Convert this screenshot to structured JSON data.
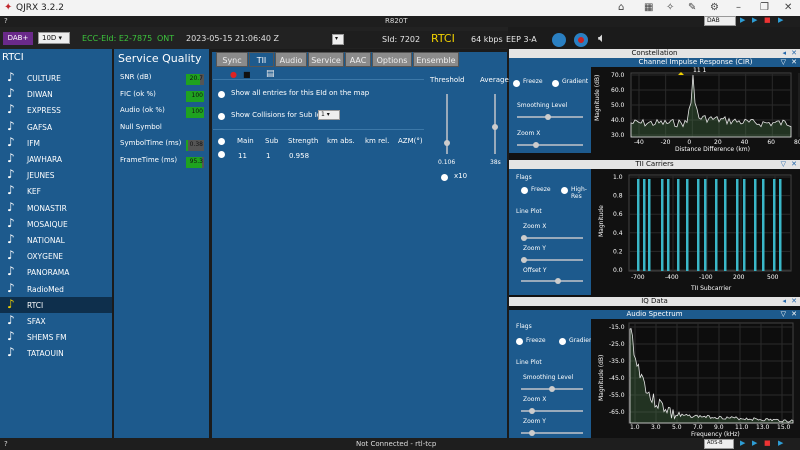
{
  "window": {
    "title": "QJRX 3.2.2"
  },
  "menu": {
    "label": "?"
  },
  "device": {
    "name": "R820T"
  },
  "toolbar": {
    "mode": "DAB+",
    "channel": "10D",
    "ecc_eid": "ECC-EId: E2-7875",
    "ont": "ONT",
    "timestamp": "2023-05-15  21:06:40 Z",
    "sid": "SId: 7202",
    "station": "RTCI",
    "bitrate": "64 kbps",
    "eep": "EEP 3-A",
    "mode_right": "DAB"
  },
  "stations": {
    "header": "RTCI",
    "items": [
      "CULTURE",
      "DIWAN",
      "EXPRESS",
      "GAFSA",
      "IFM",
      "JAWHARA",
      "JEUNES",
      "KEF",
      "MONASTIR",
      "MOSAIQUE",
      "NATIONAL",
      "OXYGENE",
      "PANORAMA",
      "RadioMed",
      "RTCI",
      "SFAX",
      "SHEMS FM",
      "TATAOUIN"
    ],
    "selected": "RTCI"
  },
  "service_quality": {
    "title": "Service Quality",
    "rows": [
      {
        "label": "SNR (dB)",
        "value": "20.7",
        "fill": 0.8
      },
      {
        "label": "FIC (ok %)",
        "value": "100",
        "fill": 1.0
      },
      {
        "label": "Audio (ok %)",
        "value": "100",
        "fill": 1.0
      },
      {
        "label": "Null Symbol",
        "value": "",
        "fill": 0
      },
      {
        "label": "SymbolTime (ms)",
        "value": "0.38",
        "fill": 0.1
      },
      {
        "label": "FrameTime (ms)",
        "value": "95.3",
        "fill": 0.9
      }
    ]
  },
  "tabs": [
    "Sync",
    "TII",
    "Audio",
    "Service",
    "AAC",
    "Options",
    "Ensemble"
  ],
  "tii": {
    "show_all": "Show all entries for this EId on the map",
    "show_collisions": "Show Collisions for Sub Id",
    "sub_id": "1",
    "columns": [
      "Main",
      "Sub",
      "Strength",
      "km abs.",
      "km rel.",
      "AZM(°)"
    ],
    "row": [
      "11",
      "1",
      "0.958",
      "",
      "",
      ""
    ],
    "threshold_label": "Threshold",
    "threshold_value": "0.106",
    "average_label": "Average",
    "average_value": "38s",
    "x10": "x10"
  },
  "constellation": {
    "title": "Constellation",
    "plot_title": "Channel Impulse Response (CIR)",
    "freeze": "Freeze",
    "gradient": "Gradient",
    "smoothing": "Smoothing Level",
    "zoom_x": "Zoom X",
    "peak_label": "11 1",
    "xlabel": "Distance Difference (km)",
    "ylabel": "Magnitude (dB)",
    "xticks": [
      "-40",
      "-20",
      "0",
      "20",
      "40",
      "60",
      "80"
    ],
    "yticks": [
      "70.0",
      "60.0",
      "50.0",
      "40.0",
      "30.0"
    ]
  },
  "tii_carriers": {
    "title": "TII Carriers",
    "flags": "Flags",
    "freeze": "Freeze",
    "highres": "High-Res",
    "line_plot": "Line Plot",
    "zoom_x": "Zoom X",
    "zoom_y": "Zoom Y",
    "offset_y": "Offset Y",
    "xlabel": "TII Subcarrier",
    "ylabel": "Magnitude",
    "xticks": [
      "-700",
      "-400",
      "-100",
      "200",
      "500"
    ],
    "yticks": [
      "1.0",
      "0.8",
      "0.6",
      "0.4",
      "0.2",
      "0.0"
    ]
  },
  "iq": {
    "title": "IQ Data"
  },
  "audio_spectrum": {
    "title": "Audio Spectrum",
    "flags": "Flags",
    "freeze": "Freeze",
    "gradient": "Gradient",
    "line_plot": "Line Plot",
    "smoothing": "Smoothing Level",
    "zoom_x": "Zoom X",
    "zoom_y": "Zoom Y",
    "xlabel": "Frequency (kHz)",
    "ylabel": "Magnitude (dB)",
    "xticks": [
      "1.0",
      "3.0",
      "5.0",
      "7.0",
      "9.0",
      "11.0",
      "13.0",
      "15.0"
    ],
    "yticks": [
      "-15.0",
      "-25.0",
      "-35.0",
      "-45.0",
      "-55.0",
      "-65.0"
    ]
  },
  "status": {
    "help": "?",
    "connection": "Not Connected - rtl-tcp",
    "right": "ADS-B"
  },
  "colors": {
    "panel": "#1d5a8d",
    "accent": "#f0d000",
    "good": "#1fa21f",
    "bars": "#3ab7c8"
  }
}
